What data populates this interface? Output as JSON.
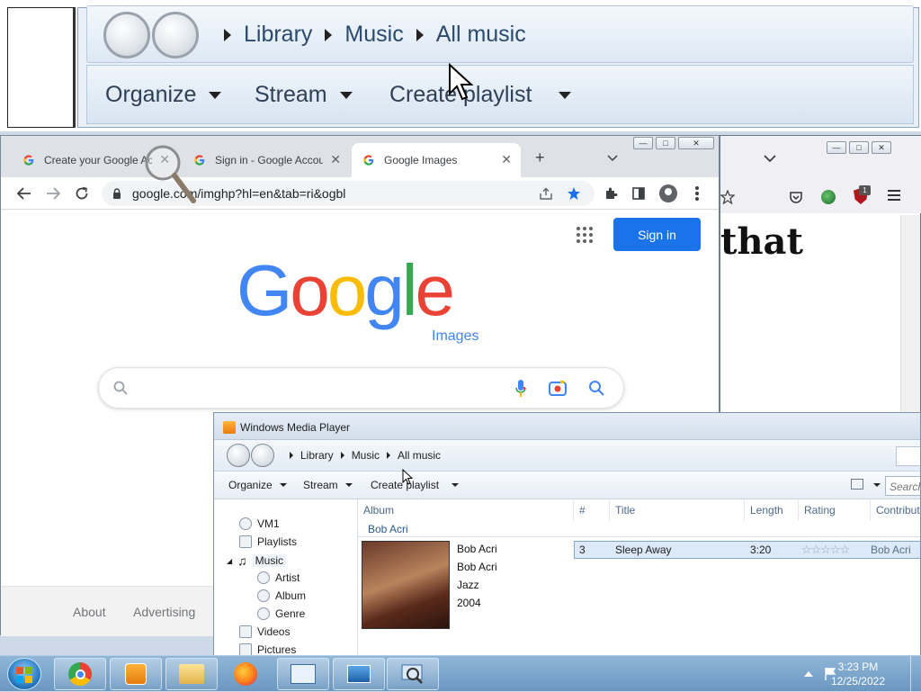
{
  "magnified": {
    "breadcrumb": [
      "Library",
      "Music",
      "All music"
    ],
    "toolbar": [
      "Organize",
      "Stream",
      "Create playlist"
    ]
  },
  "chrome": {
    "tabs": [
      {
        "title": "Create your Google Acco"
      },
      {
        "title": "Sign in - Google Accoun"
      },
      {
        "title": "Google Images"
      }
    ],
    "url": "google.com/imghp?hl=en&tab=ri&ogbl",
    "signin_label": "Sign in",
    "logo_letters": [
      "G",
      "o",
      "o",
      "g",
      "l",
      "e"
    ],
    "logo_sub": "Images",
    "footer": [
      "About",
      "Advertising"
    ],
    "colors": {
      "blue": "#4285f4",
      "red": "#ea4335",
      "yellow": "#fbbc05",
      "green": "#34a853"
    }
  },
  "firefox": {
    "badge": "1",
    "page_text": "that"
  },
  "wmp": {
    "title": "Windows Media Player",
    "breadcrumb": [
      "Library",
      "Music",
      "All music"
    ],
    "toolbar": [
      "Organize",
      "Stream",
      "Create playlist"
    ],
    "search_placeholder": "Search",
    "tree": [
      "VM1",
      "Playlists",
      "Music",
      "Artist",
      "Album",
      "Genre",
      "Videos",
      "Pictures"
    ],
    "columns": [
      "Album",
      "#",
      "Title",
      "Length",
      "Rating",
      "Contributing"
    ],
    "group": "Bob Acri",
    "album_meta": [
      "Bob Acri",
      "Bob Acri",
      "Jazz",
      "2004"
    ],
    "track": {
      "num": "3",
      "title": "Sleep Away",
      "length": "3:20",
      "contributing": "Bob Acri"
    }
  },
  "taskbar": {
    "time": "3:23 PM",
    "date": "12/25/2022"
  }
}
